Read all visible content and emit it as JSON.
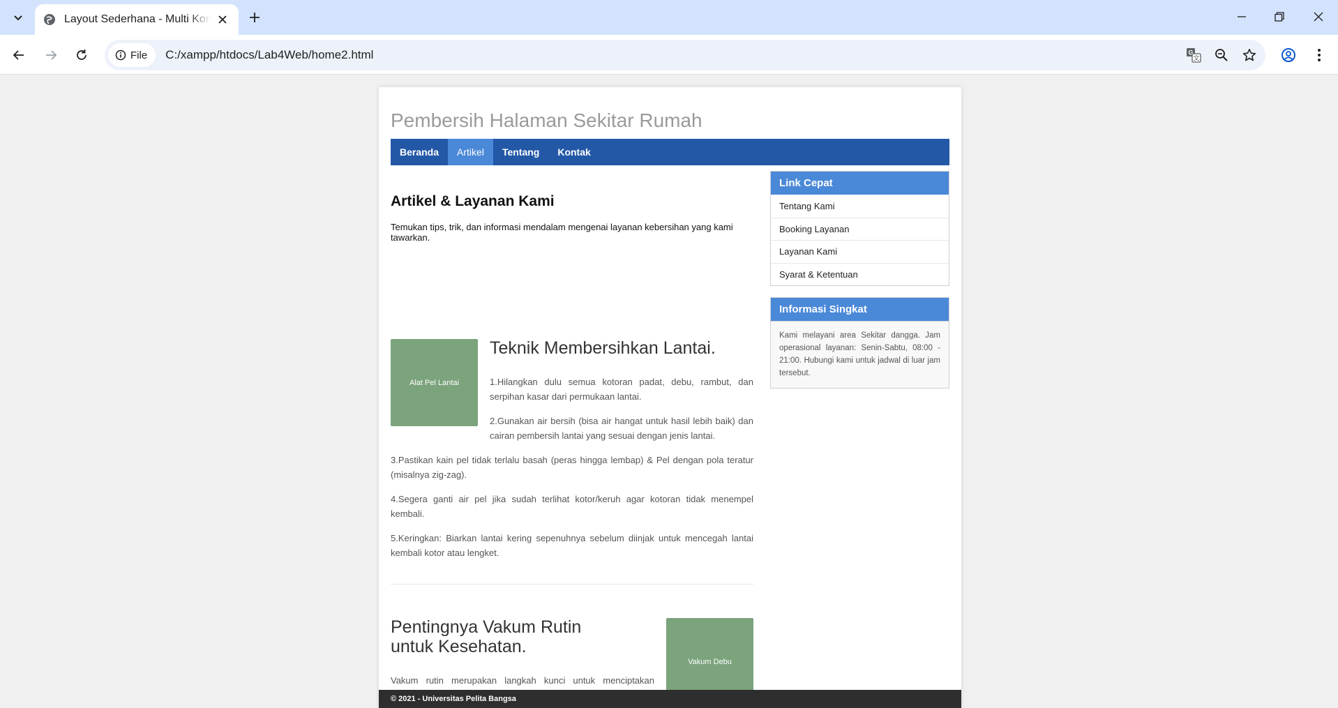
{
  "browser": {
    "tab_title": "Layout Sederhana - Multi Konten",
    "file_chip": "File",
    "url": "C:/xampp/htdocs/Lab4Web/home2.html"
  },
  "site": {
    "title": "Pembersih Halaman Sekitar Rumah",
    "nav": [
      {
        "label": "Beranda",
        "active": false
      },
      {
        "label": "Artikel",
        "active": true
      },
      {
        "label": "Tentang",
        "active": false
      },
      {
        "label": "Kontak",
        "active": false
      }
    ]
  },
  "main": {
    "title": "Artikel & Layanan Kami",
    "intro": "Temukan tips, trik, dan informasi mendalam mengenai layanan kebersihan yang kami tawarkan.",
    "article1": {
      "image_label": "Alat Pel Lantai",
      "heading": "Teknik Membersihkan Lantai.",
      "steps": [
        "1.Hilangkan dulu semua kotoran padat, debu, rambut, dan serpihan kasar dari permukaan lantai.",
        "2.Gunakan air bersih (bisa air hangat untuk hasil lebih baik) dan cairan pembersih lantai yang sesuai dengan jenis lantai.",
        "3.Pastikan kain pel tidak terlalu basah (peras hingga lembap) & Pel dengan pola teratur (misalnya zig-zag).",
        "4.Segera ganti air pel jika sudah terlihat kotor/keruh agar kotoran tidak menempel kembali.",
        "5.Keringkan: Biarkan lantai kering sepenuhnya sebelum diinjak untuk mencegah lantai kembali kotor atau lengket."
      ]
    },
    "article2": {
      "image_label": "Vakum Debu",
      "heading": "Pentingnya Vakum Rutin untuk Kesehatan.",
      "body": "Vakum rutin merupakan langkah kunci untuk menciptakan lingkungan hidup yang sehat dan aman, melindungi kesehatan keluarga dari penyakit pernapasan yang dipicu oleh polutan dan alergen di rumah."
    }
  },
  "sidebar": {
    "links_title": "Link Cepat",
    "links": [
      "Tentang Kami",
      "Booking Layanan",
      "Layanan Kami",
      "Syarat & Ketentuan"
    ],
    "info_title": "Informasi Singkat",
    "info_text": "Kami melayani area Sekitar dangga. Jam operasional layanan: Senin-Sabtu, 08:00 - 21:00. Hubungi kami untuk jadwal di luar jam tersebut."
  },
  "footer": {
    "text": "© 2021 - Universitas Pelita Bangsa"
  },
  "colors": {
    "nav_bg": "#2358a7",
    "nav_active": "#4a88d8",
    "image_placeholder": "#7ba37c",
    "footer_bg": "#2e2e2e"
  }
}
